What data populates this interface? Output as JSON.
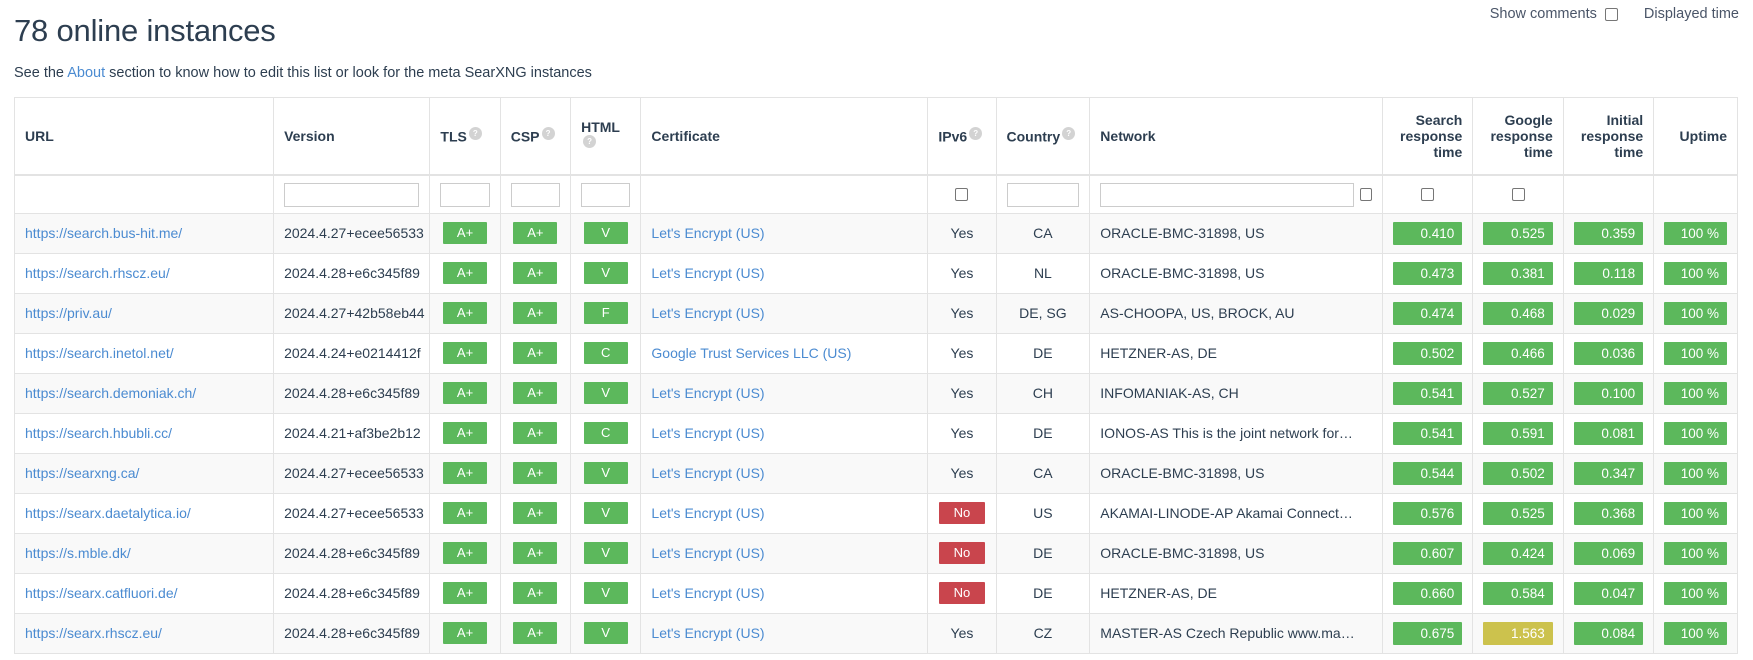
{
  "topbar": {
    "show_comments_label": "Show comments",
    "displayed_time_label": "Displayed time"
  },
  "heading": {
    "title": "78 online instances",
    "subtitle_before": "See the ",
    "about_link": "About",
    "subtitle_after": " section to know how to edit this list or look for the meta SearXNG instances"
  },
  "colors": {
    "green": "#5cb85c",
    "red": "#c9454d",
    "yellow": "#ccc24d",
    "link": "#4b8bd1",
    "text": "#2d3e50"
  },
  "table": {
    "headers": {
      "url": "URL",
      "version": "Version",
      "tls": "TLS",
      "csp": "CSP",
      "html": "HTML",
      "certificate": "Certificate",
      "ipv6": "IPv6",
      "country": "Country",
      "network": "Network",
      "search_response_time": "Search response time",
      "google_response_time": "Google response time",
      "initial_response_time": "Initial response time",
      "uptime": "Uptime"
    },
    "help_glyph": "?",
    "filters": {
      "version": "",
      "tls": "",
      "csp": "",
      "html": "",
      "country": "",
      "network": ""
    },
    "rows": [
      {
        "url": "https://search.bus-hit.me/",
        "version": "2024.4.27+ecee56533",
        "tls": "A+",
        "csp": "A+",
        "html": "V",
        "certificate": "Let's Encrypt (US)",
        "ipv6": "Yes",
        "country": "CA",
        "network": "ORACLE-BMC-31898, US",
        "search_time": "0.410",
        "search_state": "ok",
        "google_time": "0.525",
        "google_state": "ok",
        "initial_time": "0.359",
        "initial_state": "ok",
        "uptime": "100 %",
        "uptime_state": "ok"
      },
      {
        "url": "https://search.rhscz.eu/",
        "version": "2024.4.28+e6c345f89",
        "tls": "A+",
        "csp": "A+",
        "html": "V",
        "certificate": "Let's Encrypt (US)",
        "ipv6": "Yes",
        "country": "NL",
        "network": "ORACLE-BMC-31898, US",
        "search_time": "0.473",
        "search_state": "ok",
        "google_time": "0.381",
        "google_state": "ok",
        "initial_time": "0.118",
        "initial_state": "ok",
        "uptime": "100 %",
        "uptime_state": "ok"
      },
      {
        "url": "https://priv.au/",
        "version": "2024.4.27+42b58eb44",
        "tls": "A+",
        "csp": "A+",
        "html": "F",
        "certificate": "Let's Encrypt (US)",
        "ipv6": "Yes",
        "country": "DE, SG",
        "network": "AS-CHOOPA, US, BROCK, AU",
        "search_time": "0.474",
        "search_state": "ok",
        "google_time": "0.468",
        "google_state": "ok",
        "initial_time": "0.029",
        "initial_state": "ok",
        "uptime": "100 %",
        "uptime_state": "ok"
      },
      {
        "url": "https://search.inetol.net/",
        "version": "2024.4.24+e0214412f",
        "tls": "A+",
        "csp": "A+",
        "html": "C",
        "certificate": "Google Trust Services LLC (US)",
        "ipv6": "Yes",
        "country": "DE",
        "network": "HETZNER-AS, DE",
        "search_time": "0.502",
        "search_state": "ok",
        "google_time": "0.466",
        "google_state": "ok",
        "initial_time": "0.036",
        "initial_state": "ok",
        "uptime": "100 %",
        "uptime_state": "ok"
      },
      {
        "url": "https://search.demoniak.ch/",
        "version": "2024.4.28+e6c345f89",
        "tls": "A+",
        "csp": "A+",
        "html": "V",
        "certificate": "Let's Encrypt (US)",
        "ipv6": "Yes",
        "country": "CH",
        "network": "INFOMANIAK-AS, CH",
        "search_time": "0.541",
        "search_state": "ok",
        "google_time": "0.527",
        "google_state": "ok",
        "initial_time": "0.100",
        "initial_state": "ok",
        "uptime": "100 %",
        "uptime_state": "ok"
      },
      {
        "url": "https://search.hbubli.cc/",
        "version": "2024.4.21+af3be2b12",
        "tls": "A+",
        "csp": "A+",
        "html": "C",
        "certificate": "Let's Encrypt (US)",
        "ipv6": "Yes",
        "country": "DE",
        "network": "IONOS-AS This is the joint network for…",
        "search_time": "0.541",
        "search_state": "ok",
        "google_time": "0.591",
        "google_state": "ok",
        "initial_time": "0.081",
        "initial_state": "ok",
        "uptime": "100 %",
        "uptime_state": "ok"
      },
      {
        "url": "https://searxng.ca/",
        "version": "2024.4.27+ecee56533",
        "tls": "A+",
        "csp": "A+",
        "html": "V",
        "certificate": "Let's Encrypt (US)",
        "ipv6": "Yes",
        "country": "CA",
        "network": "ORACLE-BMC-31898, US",
        "search_time": "0.544",
        "search_state": "ok",
        "google_time": "0.502",
        "google_state": "ok",
        "initial_time": "0.347",
        "initial_state": "ok",
        "uptime": "100 %",
        "uptime_state": "ok"
      },
      {
        "url": "https://searx.daetalytica.io/",
        "version": "2024.4.27+ecee56533",
        "tls": "A+",
        "csp": "A+",
        "html": "V",
        "certificate": "Let's Encrypt (US)",
        "ipv6": "No",
        "country": "US",
        "network": "AKAMAI-LINODE-AP Akamai Connect…",
        "search_time": "0.576",
        "search_state": "ok",
        "google_time": "0.525",
        "google_state": "ok",
        "initial_time": "0.368",
        "initial_state": "ok",
        "uptime": "100 %",
        "uptime_state": "ok"
      },
      {
        "url": "https://s.mble.dk/",
        "version": "2024.4.28+e6c345f89",
        "tls": "A+",
        "csp": "A+",
        "html": "V",
        "certificate": "Let's Encrypt (US)",
        "ipv6": "No",
        "country": "DE",
        "network": "ORACLE-BMC-31898, US",
        "search_time": "0.607",
        "search_state": "ok",
        "google_time": "0.424",
        "google_state": "ok",
        "initial_time": "0.069",
        "initial_state": "ok",
        "uptime": "100 %",
        "uptime_state": "ok"
      },
      {
        "url": "https://searx.catfluori.de/",
        "version": "2024.4.28+e6c345f89",
        "tls": "A+",
        "csp": "A+",
        "html": "V",
        "certificate": "Let's Encrypt (US)",
        "ipv6": "No",
        "country": "DE",
        "network": "HETZNER-AS, DE",
        "search_time": "0.660",
        "search_state": "ok",
        "google_time": "0.584",
        "google_state": "ok",
        "initial_time": "0.047",
        "initial_state": "ok",
        "uptime": "100 %",
        "uptime_state": "ok"
      },
      {
        "url": "https://searx.rhscz.eu/",
        "version": "2024.4.28+e6c345f89",
        "tls": "A+",
        "csp": "A+",
        "html": "V",
        "certificate": "Let's Encrypt (US)",
        "ipv6": "Yes",
        "country": "CZ",
        "network": "MASTER-AS Czech Republic www.ma…",
        "search_time": "0.675",
        "search_state": "ok",
        "google_time": "1.563",
        "google_state": "warn",
        "initial_time": "0.084",
        "initial_state": "ok",
        "uptime": "100 %",
        "uptime_state": "ok"
      }
    ]
  }
}
